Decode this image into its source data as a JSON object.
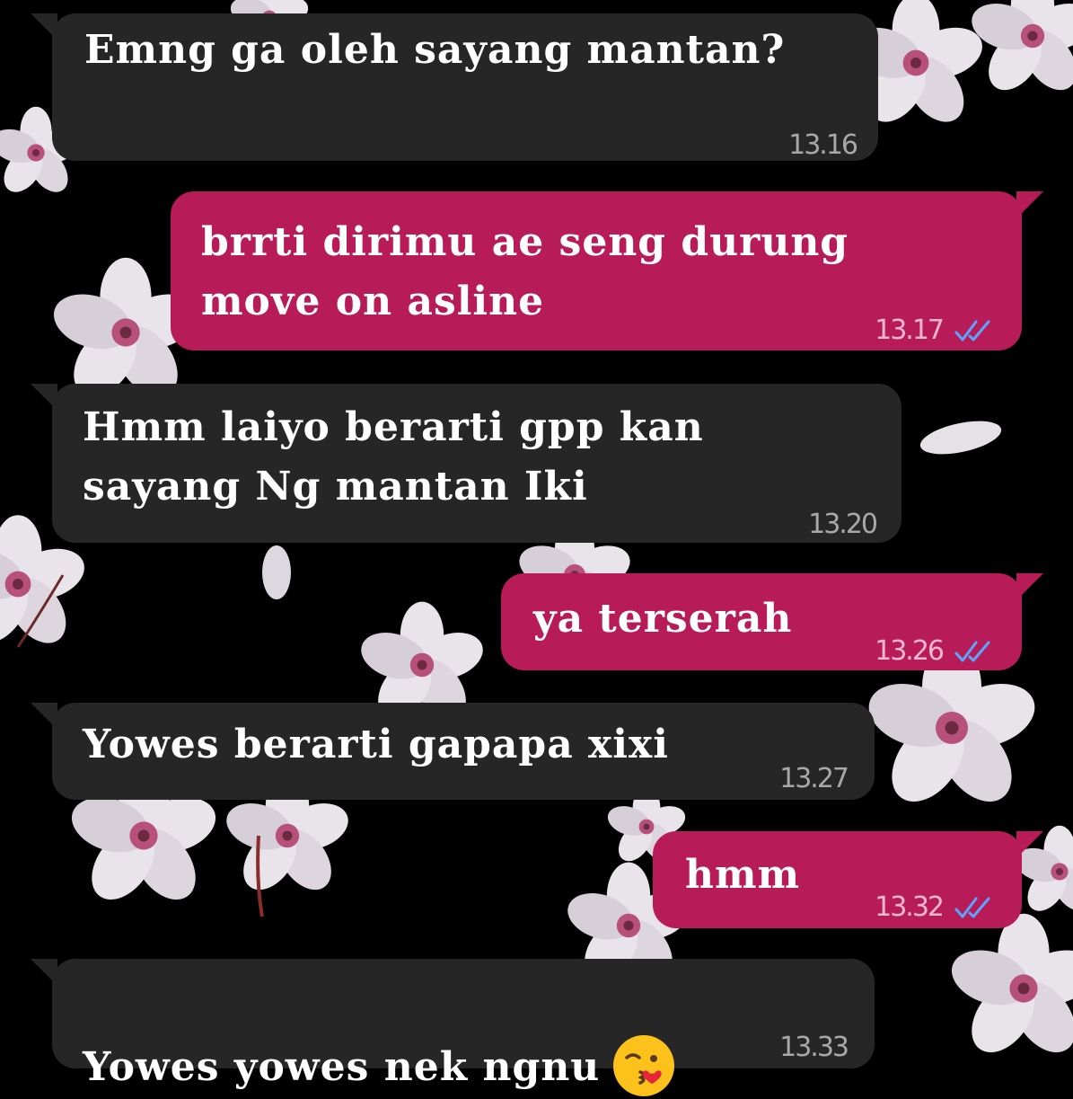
{
  "theme": {
    "background": "#000000",
    "incoming_bubble": "#262626",
    "outgoing_bubble": "#b81c58",
    "read_ticks": "#5aa6ff"
  },
  "messages": [
    {
      "direction": "incoming",
      "text": "Emng ga oleh sayang mantan?",
      "time": "13.16"
    },
    {
      "direction": "outgoing",
      "text": "brrti dirimu ae seng durung move on asline",
      "time": "13.17",
      "status": "read-double-check-icon"
    },
    {
      "direction": "incoming",
      "text": "Hmm laiyo berarti gpp kan sayang Ng mantan Iki",
      "time": "13.20"
    },
    {
      "direction": "outgoing",
      "text": "ya terserah",
      "time": "13.26",
      "status": "read-double-check-icon"
    },
    {
      "direction": "incoming",
      "text": "Yowes berarti gapapa xixi",
      "time": "13.27"
    },
    {
      "direction": "outgoing",
      "text": "hmm",
      "time": "13.32",
      "status": "read-double-check-icon"
    },
    {
      "direction": "incoming",
      "text": "Yowes yowes nek ngnu",
      "time": "13.33",
      "emoji": "face-blowing-kiss-emoji"
    }
  ]
}
